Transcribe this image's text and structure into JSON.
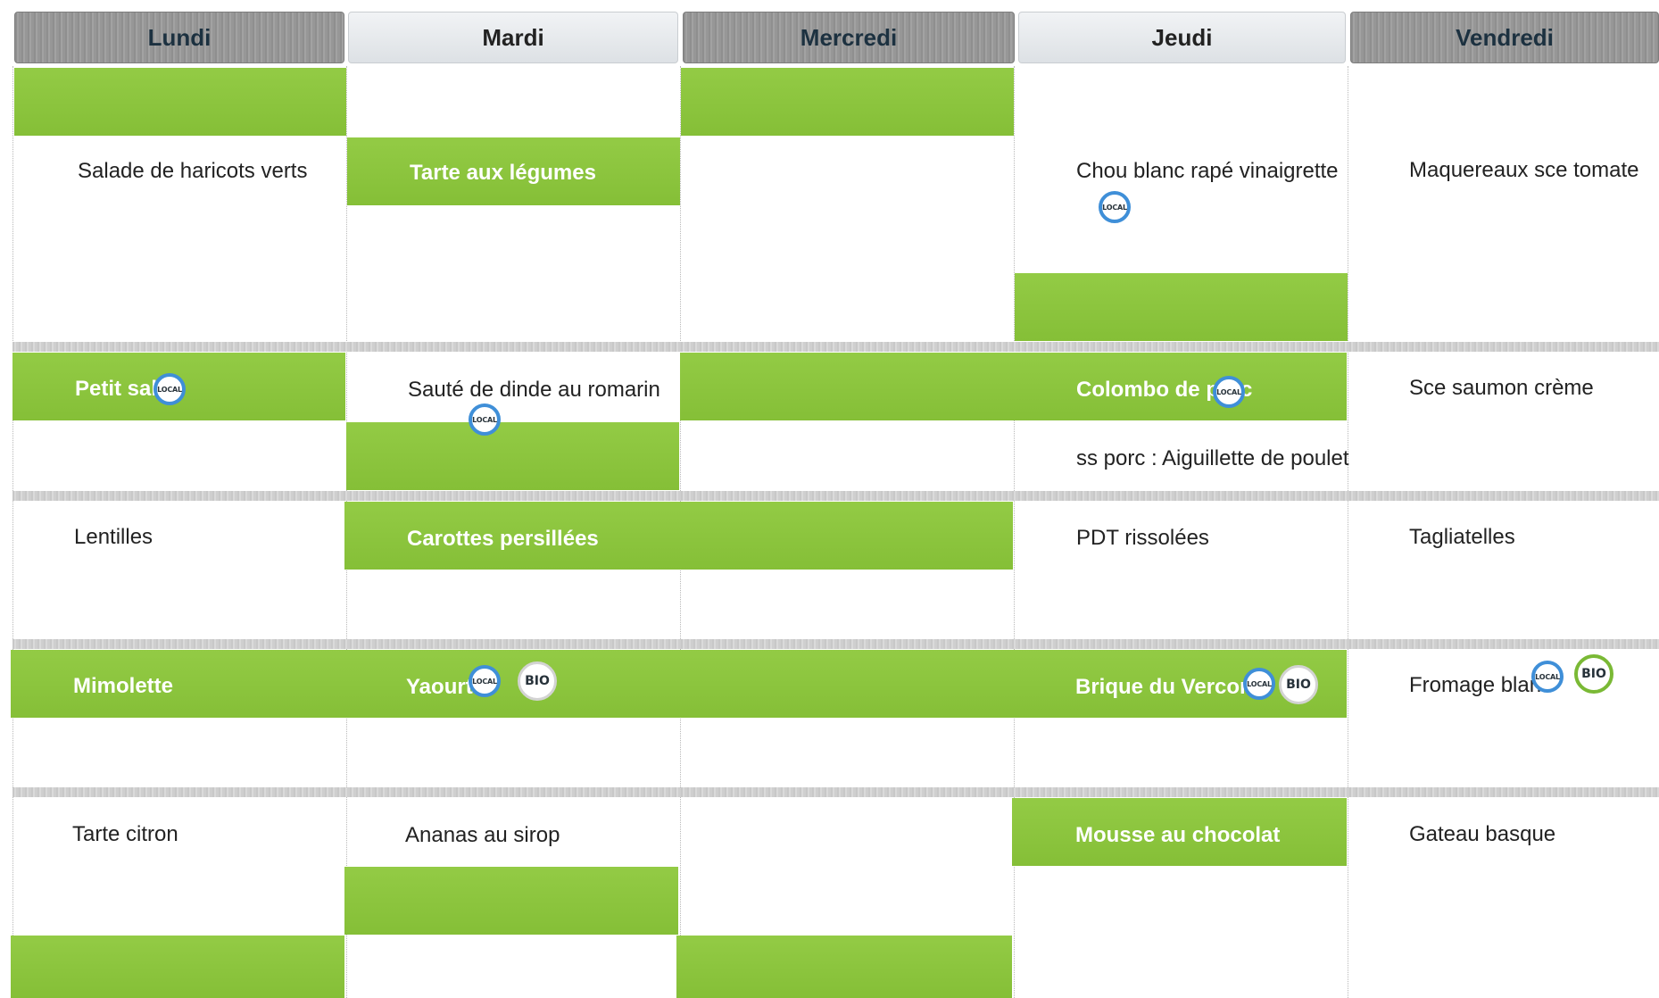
{
  "days": [
    "Lundi",
    "Mardi",
    "Mercredi",
    "Jeudi",
    "Vendredi"
  ],
  "badges": {
    "local": "LOCAL",
    "bio": "BIO"
  },
  "dishes": {
    "lundi": {
      "entree": "Salade de haricots verts",
      "plat": "Petit salé",
      "accompagnement": "Lentilles",
      "fromage": "Mimolette",
      "dessert": "Tarte citron"
    },
    "mardi": {
      "entree": "Tarte aux légumes",
      "plat": "Sauté de dinde au romarin",
      "accompagnement": "Carottes persillées",
      "fromage": "Yaourt",
      "dessert": "Ananas au sirop"
    },
    "jeudi": {
      "entree": "Chou blanc rapé vinaigrette",
      "plat": "Colombo de porc",
      "alternative": "ss porc : Aiguillette de poulet",
      "accompagnement": "PDT rissolées",
      "fromage": "Brique du Vercors",
      "dessert": "Mousse au chocolat"
    },
    "vendredi": {
      "entree": "Maquereaux sce tomate",
      "plat": "Sce saumon crème",
      "accompagnement": "Tagliatelles",
      "fromage": "Fromage blanc",
      "dessert": "Gateau basque"
    }
  },
  "colors": {
    "green": "#8cc63f",
    "header_dark": "#979797",
    "header_light": "#e6e9ec"
  }
}
